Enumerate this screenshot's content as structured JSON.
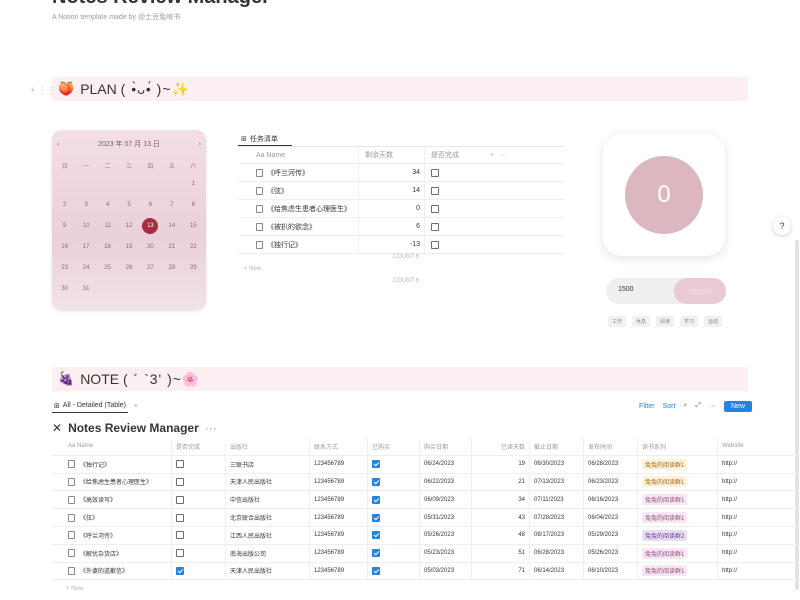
{
  "page": {
    "title": "Notes Review Manager",
    "subtitle": "A Notion template made by @土豆兔啃书"
  },
  "plan": {
    "emoji": "🍑",
    "label": "PLAN",
    "kaomoji": "( •̀ᴗ•́ )~✨"
  },
  "note": {
    "emoji": "🍇",
    "label": "NOTE",
    "kaomoji": "( ´ `3' )~🌸"
  },
  "calendar": {
    "header": "2023 年 07 月 13 日",
    "prev": "‹",
    "next": "›",
    "weekdays": [
      "日",
      "一",
      "二",
      "三",
      "四",
      "五",
      "六"
    ],
    "days": [
      "",
      "",
      "",
      "",
      "",
      "",
      "1",
      "2",
      "3",
      "4",
      "5",
      "6",
      "7",
      "8",
      "9",
      "10",
      "11",
      "12",
      "13",
      "14",
      "15",
      "16",
      "17",
      "18",
      "19",
      "20",
      "21",
      "22",
      "23",
      "24",
      "25",
      "26",
      "27",
      "28",
      "29",
      "30",
      "31",
      "",
      "",
      "",
      "",
      ""
    ],
    "today": "13"
  },
  "tasks": {
    "tab_label": "任务清单",
    "col_name": "Aa Name",
    "col_days": "剩余天数",
    "col_done": "是否完成",
    "col_add": "+",
    "col_more": "···",
    "rows": [
      {
        "name": "《呼兰河传》",
        "days": "34",
        "done": false
      },
      {
        "name": "《弦》",
        "days": "14",
        "done": false
      },
      {
        "name": "《给焦虑生患者心理医生》",
        "days": "0",
        "done": false
      },
      {
        "name": "《被扒的欲念》",
        "days": "6",
        "done": false
      },
      {
        "name": "《独行记》",
        "days": "-13",
        "done": false
      }
    ],
    "count_1": "COUNT 6",
    "new_label": "+ New",
    "count_2": "COUNT 6"
  },
  "counter": {
    "value": "0",
    "timer_value": "1500",
    "timer_button": "开始计时",
    "presets": [
      "工作",
      "休息",
      "阅读",
      "学习",
      "运动"
    ]
  },
  "help": "?",
  "notes": {
    "view_label": "All - Detailed (Table)",
    "view_add": "+",
    "filter": "Filter",
    "sort": "Sort",
    "new": "New",
    "more": "···",
    "columns": [
      "Aa Name",
      "是否完成",
      "出版社",
      "联系方式",
      "已购买",
      "购买日期",
      "已读天数",
      "截止日期",
      "发布时间",
      "读书系列",
      "Website"
    ],
    "rows": [
      {
        "name": "《独行记》",
        "done": false,
        "pub": "三联书店",
        "phone": "123456789",
        "bought": true,
        "date": "06/24/2023",
        "days": "19",
        "due": "06/30/2023",
        "pubdate": "06/28/2023",
        "tag": "兔兔的阅读群1",
        "tag_class": "y",
        "site": "http://"
      },
      {
        "name": "《给焦虑生患者心理医生》",
        "done": false,
        "pub": "天津人民出版社",
        "phone": "123456789",
        "bought": true,
        "date": "06/22/2023",
        "days": "21",
        "due": "07/13/2023",
        "pubdate": "06/23/2023",
        "tag": "兔兔的阅读群1",
        "tag_class": "y",
        "site": "http://"
      },
      {
        "name": "《高效读写》",
        "done": false,
        "pub": "中信出版社",
        "phone": "123456789",
        "bought": true,
        "date": "06/09/2023",
        "days": "34",
        "due": "07/11/2023",
        "pubdate": "06/16/2023",
        "tag": "兔兔的阅读群1",
        "tag_class": "p",
        "site": "http://"
      },
      {
        "name": "《弦》",
        "done": false,
        "pub": "北京联合出版社",
        "phone": "123456789",
        "bought": true,
        "date": "05/31/2023",
        "days": "43",
        "due": "07/28/2023",
        "pubdate": "06/04/2023",
        "tag": "兔兔的阅读群1",
        "tag_class": "p",
        "site": "http://"
      },
      {
        "name": "《呼兰河传》",
        "done": false,
        "pub": "江西人民出版社",
        "phone": "123456789",
        "bought": true,
        "date": "05/26/2023",
        "days": "48",
        "due": "08/17/2023",
        "pubdate": "05/29/2023",
        "tag": "兔兔的阅读群2",
        "tag_class": "v",
        "site": "http://"
      },
      {
        "name": "《解忧杂货店》",
        "done": false,
        "pub": "南海出版公司",
        "phone": "123456789",
        "bought": true,
        "date": "05/23/2023",
        "days": "51",
        "due": "06/28/2023",
        "pubdate": "05/26/2023",
        "tag": "兔兔的阅读群1",
        "tag_class": "p",
        "site": "http://"
      },
      {
        "name": "《外婆的道歉信》",
        "done": true,
        "pub": "天津人民出版社",
        "phone": "123456789",
        "bought": true,
        "date": "05/03/2023",
        "days": "71",
        "due": "06/14/2023",
        "pubdate": "06/10/2023",
        "tag": "兔兔的阅读群1",
        "tag_class": "p",
        "site": "http://"
      }
    ],
    "new_label": "+ New"
  }
}
